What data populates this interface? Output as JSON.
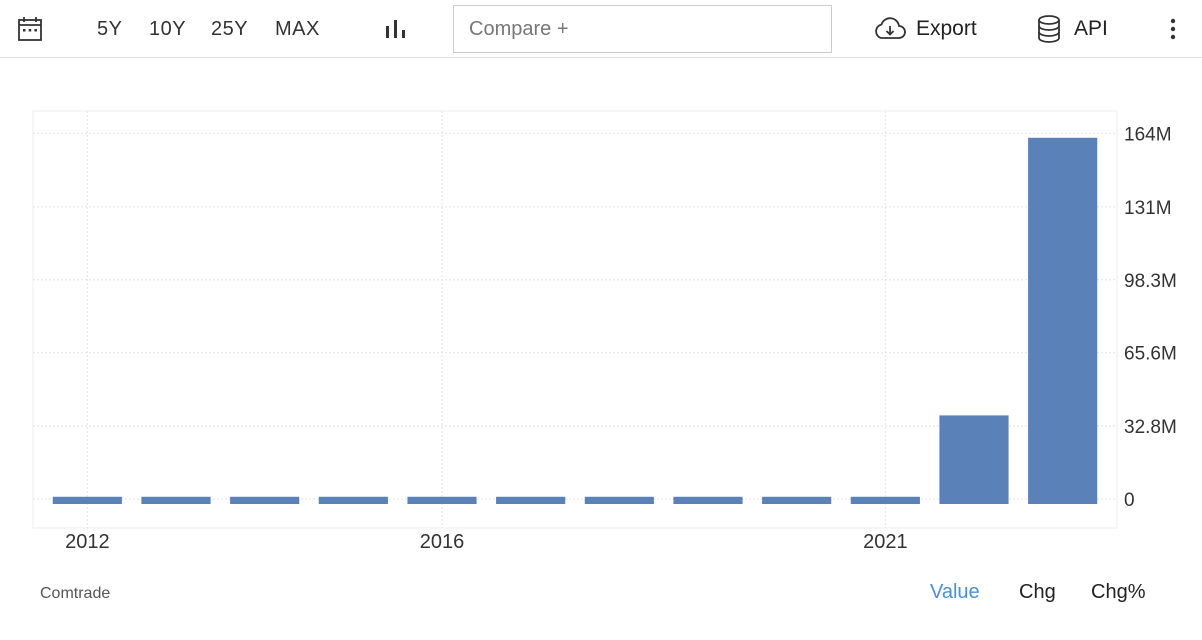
{
  "toolbar": {
    "calendar_icon": "calendar-icon",
    "ranges": [
      "5Y",
      "10Y",
      "25Y",
      "MAX"
    ],
    "chart_type_icon": "bar-chart-icon",
    "compare_placeholder": "Compare +",
    "export_label": "Export",
    "export_icon": "cloud-download-icon",
    "api_label": "API",
    "api_icon": "database-icon",
    "more_icon": "more-vertical-icon"
  },
  "footer": {
    "source": "Comtrade",
    "view_options": [
      "Value",
      "Chg",
      "Chg%"
    ],
    "active_view": "Value"
  },
  "colors": {
    "bar": "#5b81b9",
    "active_option": "#4d8fd6",
    "grid": "#e4e4e4"
  },
  "chart_data": {
    "type": "bar",
    "categories": [
      "2012",
      "2013",
      "2014",
      "2015",
      "2016",
      "2017",
      "2018",
      "2019",
      "2020",
      "2021",
      "2022",
      "2023"
    ],
    "values": [
      1000000,
      1000000,
      1000000,
      1000000,
      1000000,
      1000000,
      1000000,
      1000000,
      1000000,
      1000000,
      37500000,
      162000000
    ],
    "x_tick_labels": [
      "2012",
      "2016",
      "2021"
    ],
    "y_tick_labels": [
      "0",
      "32.8M",
      "65.6M",
      "98.3M",
      "131M",
      "164M"
    ],
    "y_ticks": [
      0,
      32800000,
      65600000,
      98300000,
      131000000,
      164000000
    ],
    "ylim": [
      -13000000,
      174000000
    ],
    "title": "",
    "xlabel": "",
    "ylabel": "",
    "grid": true,
    "y_axis_position": "right"
  }
}
